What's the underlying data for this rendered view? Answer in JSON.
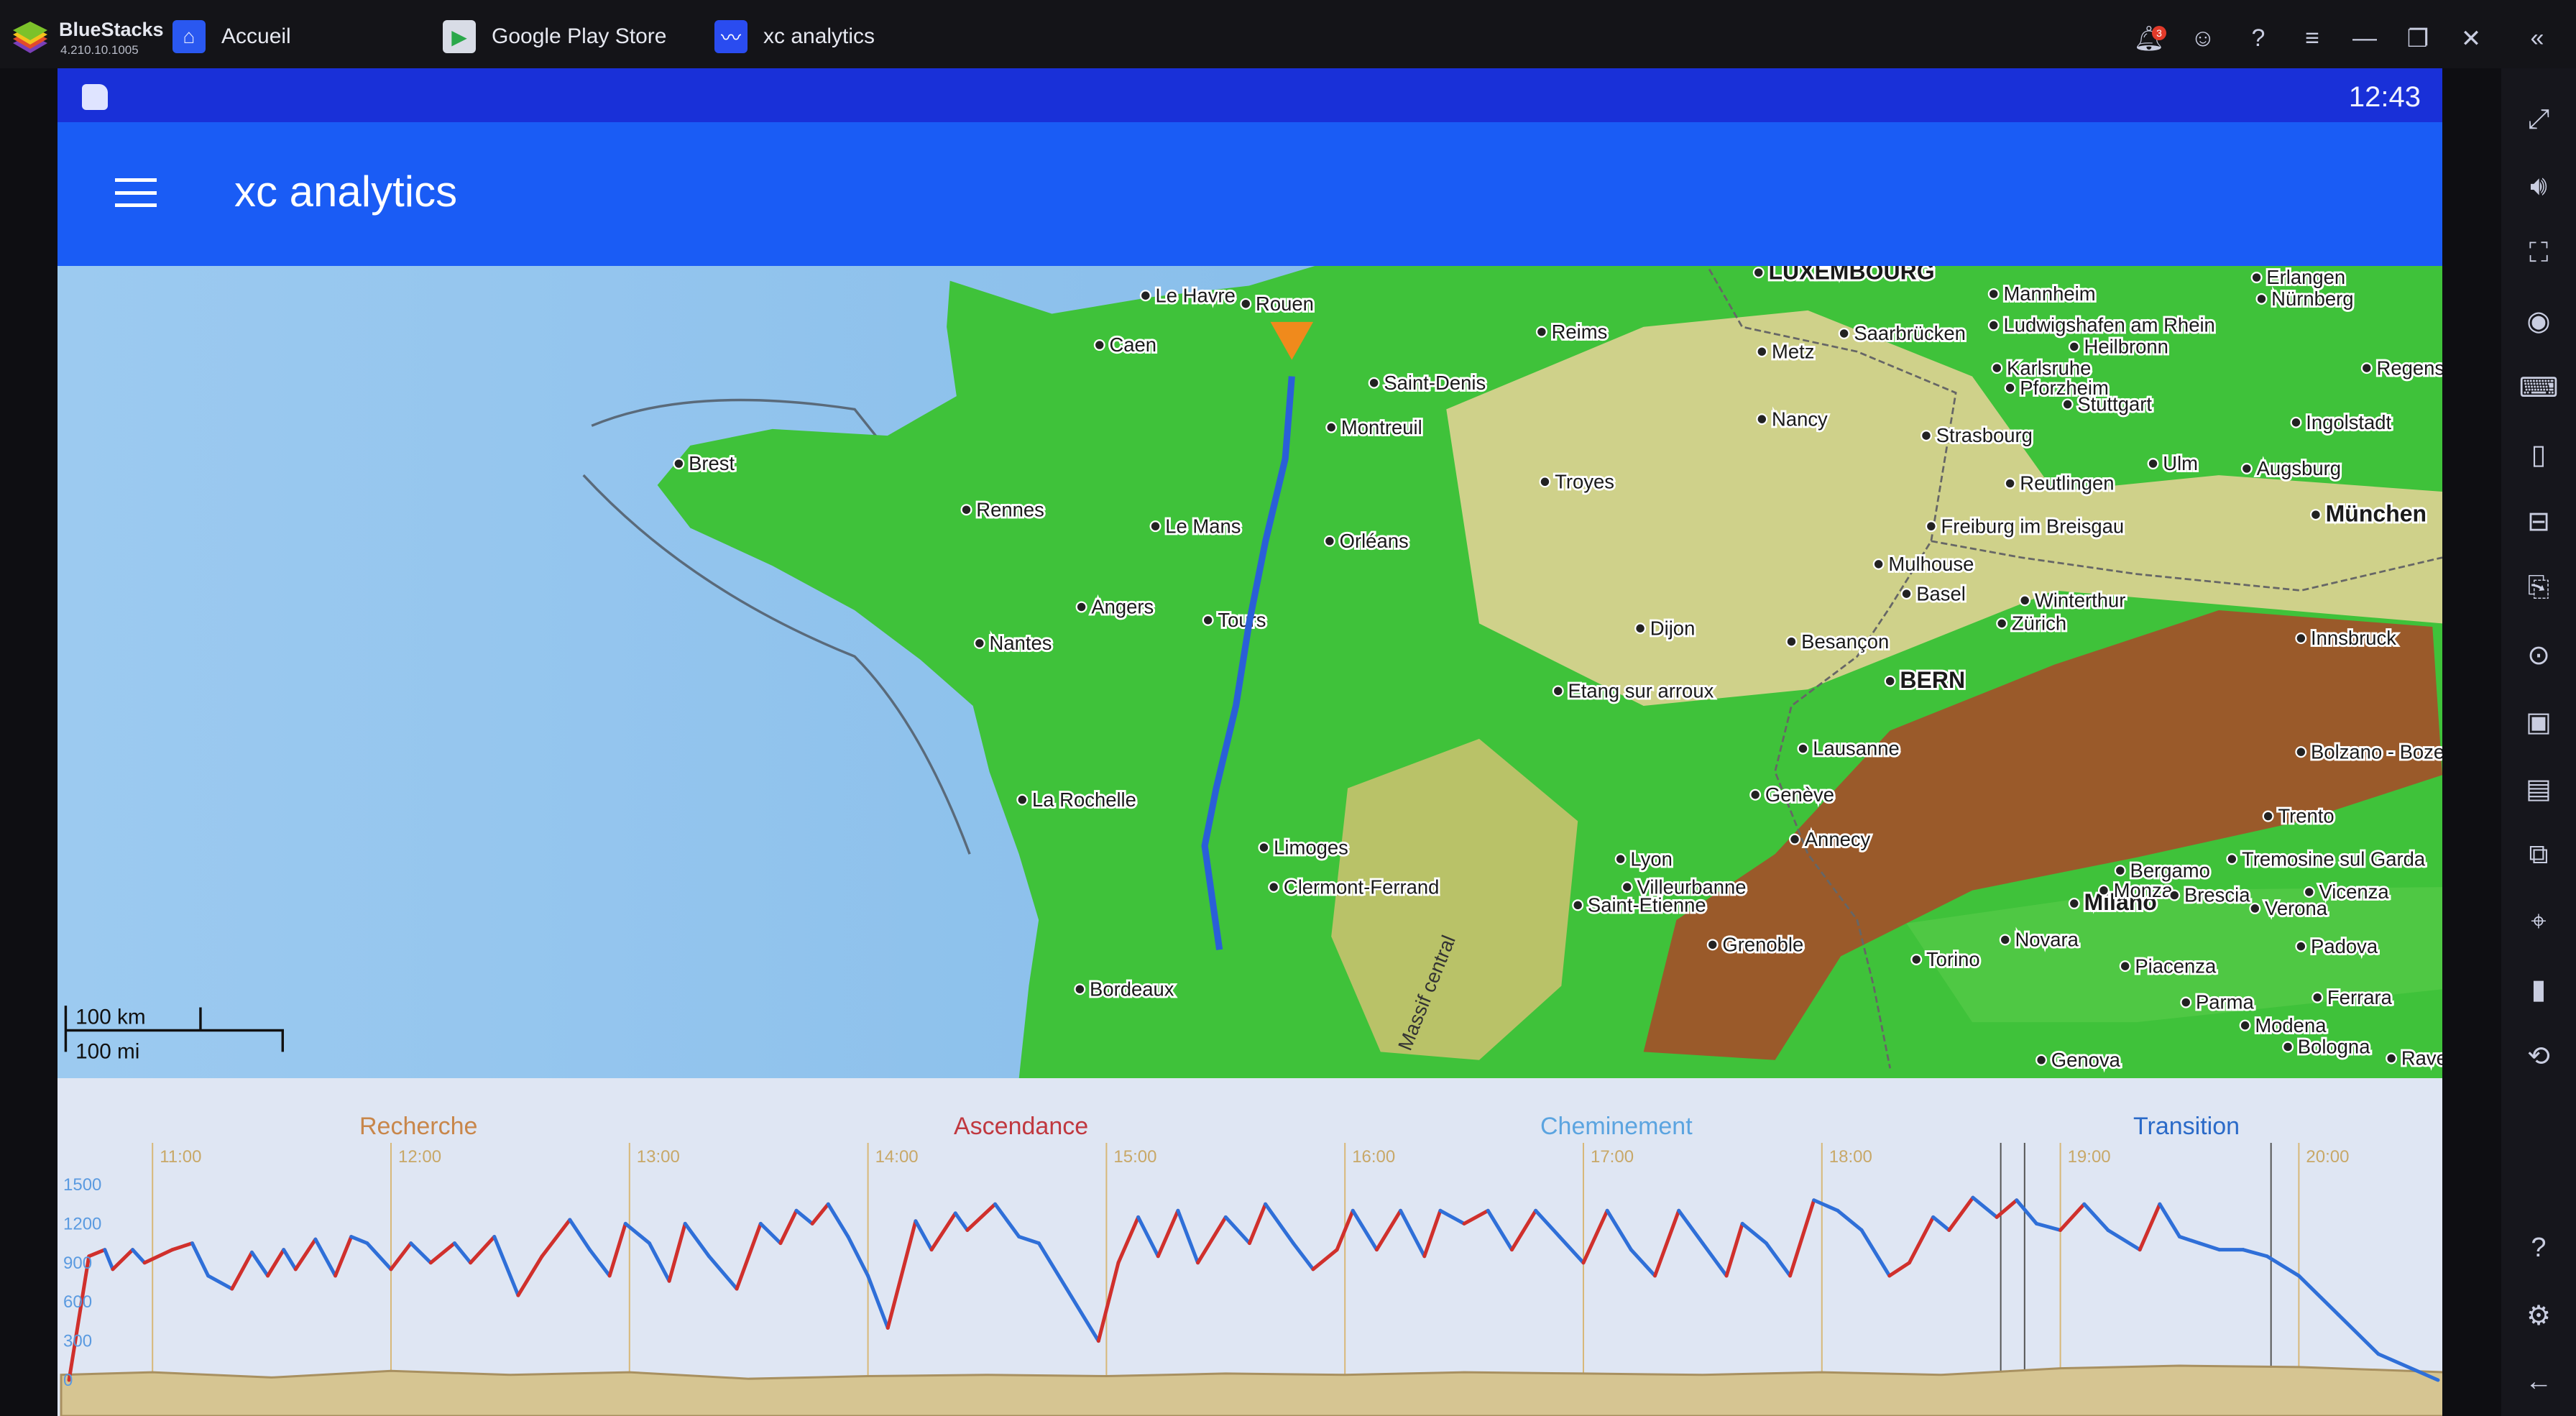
{
  "titlebar": {
    "brand": "BlueStacks",
    "version": "4.210.10.1005",
    "tabs": [
      {
        "label": "Accueil",
        "icon": "home-icon"
      },
      {
        "label": "Google Play Store",
        "icon": "play-store-icon"
      },
      {
        "label": "xc analytics",
        "icon": "xc-analytics-icon"
      }
    ],
    "notification_count": "3"
  },
  "status_bar": {
    "time": "12:43"
  },
  "app_bar": {
    "title": "xc analytics"
  },
  "map": {
    "scale": {
      "km": "100 km",
      "mi": "100 mi"
    },
    "region_labels": [
      "Massif central"
    ],
    "cities": [
      "Le Havre",
      "Rouen",
      "Caen",
      "Brest",
      "Rennes",
      "Le Mans",
      "Angers",
      "Tours",
      "Nantes",
      "Orléans",
      "Montreuil",
      "Saint-Denis",
      "Reims",
      "Troyes",
      "La Rochelle",
      "Limoges",
      "Clermont-Ferrand",
      "Bordeaux",
      "Dijon",
      "Besançon",
      "Etang sur arroux",
      "Lyon",
      "Villeurbanne",
      "Saint-Etienne",
      "Grenoble",
      "LUXEMBOURG",
      "Metz",
      "Nancy",
      "Saarbrücken",
      "Strasbourg",
      "Mulhouse",
      "Basel",
      "Freiburg im Breisgau",
      "BERN",
      "Lausanne",
      "Genève",
      "Annecy",
      "Torino",
      "Novara",
      "Milano",
      "Bergamo",
      "Monza",
      "Brescia",
      "Verona",
      "Vicenza",
      "Padova",
      "Trento",
      "Bolzano - Bozen",
      "Innsbruck",
      "München",
      "Augsburg",
      "Ingolstadt",
      "Ulm",
      "Reutlingen",
      "Stuttgart",
      "Pforzheim",
      "Karlsruhe",
      "Heilbronn",
      "Mannheim",
      "Ludwigshafen am Rhein",
      "Erlangen",
      "Nürnberg",
      "Regensburg",
      "Zürich",
      "Winterthur",
      "Piacenza",
      "Parma",
      "Modena",
      "Bologna",
      "Ferrara",
      "Genova",
      "Tremosine sul Garda",
      "Raven"
    ],
    "colors": {
      "sea": "#86c0ec",
      "lowland": "#3fc23a",
      "hills": "#d8d49a",
      "mountains": "#9a5a2a",
      "track": "#2a5fd8",
      "marker": "#f08a1c"
    }
  },
  "chart_data": {
    "type": "line",
    "phases": [
      {
        "label": "Recherche",
        "color": "#c8864a"
      },
      {
        "label": "Ascendance",
        "color": "#c0383f"
      },
      {
        "label": "Cheminement",
        "color": "#5ba4e0"
      },
      {
        "label": "Transition",
        "color": "#2a6ac8"
      }
    ],
    "x_ticks": [
      "11:00",
      "12:00",
      "13:00",
      "14:00",
      "15:00",
      "16:00",
      "17:00",
      "18:00",
      "19:00",
      "20:00"
    ],
    "y_ticks": [
      0,
      300,
      600,
      900,
      1200,
      1500
    ],
    "xlim": [
      "10:37",
      "20:37"
    ],
    "ylim": [
      0,
      1500
    ],
    "colors": {
      "climb": "#d0302c",
      "sink": "#2f6fd8",
      "ground": "#c8b27a"
    },
    "altitude": [
      [
        "10:39",
        0
      ],
      [
        "10:44",
        950
      ],
      [
        "10:48",
        1000
      ],
      [
        "10:50",
        850
      ],
      [
        "10:55",
        1000
      ],
      [
        "10:58",
        900
      ],
      [
        "11:05",
        1000
      ],
      [
        "11:10",
        1050
      ],
      [
        "11:14",
        800
      ],
      [
        "11:20",
        700
      ],
      [
        "11:25",
        980
      ],
      [
        "11:29",
        800
      ],
      [
        "11:33",
        1000
      ],
      [
        "11:36",
        850
      ],
      [
        "11:41",
        1080
      ],
      [
        "11:46",
        800
      ],
      [
        "11:50",
        1100
      ],
      [
        "11:54",
        1050
      ],
      [
        "12:00",
        850
      ],
      [
        "12:05",
        1050
      ],
      [
        "12:10",
        900
      ],
      [
        "12:16",
        1050
      ],
      [
        "12:20",
        900
      ],
      [
        "12:26",
        1100
      ],
      [
        "12:32",
        650
      ],
      [
        "12:38",
        950
      ],
      [
        "12:45",
        1230
      ],
      [
        "12:50",
        1000
      ],
      [
        "12:55",
        800
      ],
      [
        "12:59",
        1200
      ],
      [
        "13:05",
        1050
      ],
      [
        "13:10",
        760
      ],
      [
        "13:14",
        1200
      ],
      [
        "13:20",
        950
      ],
      [
        "13:27",
        700
      ],
      [
        "13:33",
        1200
      ],
      [
        "13:38",
        1050
      ],
      [
        "13:42",
        1300
      ],
      [
        "13:46",
        1200
      ],
      [
        "13:50",
        1350
      ],
      [
        "13:55",
        1100
      ],
      [
        "14:00",
        800
      ],
      [
        "14:05",
        400
      ],
      [
        "14:12",
        1220
      ],
      [
        "14:16",
        1000
      ],
      [
        "14:22",
        1280
      ],
      [
        "14:25",
        1150
      ],
      [
        "14:32",
        1350
      ],
      [
        "14:38",
        1100
      ],
      [
        "14:43",
        1050
      ],
      [
        "14:50",
        700
      ],
      [
        "14:58",
        300
      ],
      [
        "15:03",
        900
      ],
      [
        "15:08",
        1250
      ],
      [
        "15:13",
        950
      ],
      [
        "15:18",
        1300
      ],
      [
        "15:23",
        900
      ],
      [
        "15:30",
        1250
      ],
      [
        "15:36",
        1050
      ],
      [
        "15:40",
        1350
      ],
      [
        "15:47",
        1050
      ],
      [
        "15:52",
        850
      ],
      [
        "15:58",
        1000
      ],
      [
        "16:02",
        1300
      ],
      [
        "16:08",
        1000
      ],
      [
        "16:14",
        1300
      ],
      [
        "16:20",
        950
      ],
      [
        "16:24",
        1300
      ],
      [
        "16:30",
        1200
      ],
      [
        "16:36",
        1300
      ],
      [
        "16:42",
        1000
      ],
      [
        "16:48",
        1300
      ],
      [
        "16:54",
        1100
      ],
      [
        "17:00",
        900
      ],
      [
        "17:06",
        1300
      ],
      [
        "17:12",
        1000
      ],
      [
        "17:18",
        800
      ],
      [
        "17:24",
        1300
      ],
      [
        "17:30",
        1050
      ],
      [
        "17:36",
        800
      ],
      [
        "17:40",
        1200
      ],
      [
        "17:46",
        1050
      ],
      [
        "17:52",
        800
      ],
      [
        "17:58",
        1380
      ],
      [
        "18:04",
        1300
      ],
      [
        "18:10",
        1150
      ],
      [
        "18:17",
        800
      ],
      [
        "18:22",
        900
      ],
      [
        "18:28",
        1250
      ],
      [
        "18:32",
        1150
      ],
      [
        "18:38",
        1400
      ],
      [
        "18:44",
        1250
      ],
      [
        "18:49",
        1380
      ],
      [
        "18:54",
        1200
      ],
      [
        "19:00",
        1150
      ],
      [
        "19:06",
        1350
      ],
      [
        "19:12",
        1150
      ],
      [
        "19:20",
        1000
      ],
      [
        "19:25",
        1350
      ],
      [
        "19:30",
        1100
      ],
      [
        "19:35",
        1050
      ],
      [
        "19:40",
        1000
      ],
      [
        "19:46",
        1000
      ],
      [
        "19:52",
        950
      ],
      [
        "20:00",
        800
      ],
      [
        "20:10",
        500
      ],
      [
        "20:20",
        200
      ],
      [
        "20:35",
        0
      ]
    ],
    "ground": [
      [
        "10:37",
        40
      ],
      [
        "11:00",
        60
      ],
      [
        "11:30",
        20
      ],
      [
        "12:00",
        70
      ],
      [
        "12:30",
        40
      ],
      [
        "13:00",
        60
      ],
      [
        "13:30",
        10
      ],
      [
        "14:00",
        30
      ],
      [
        "14:30",
        40
      ],
      [
        "15:00",
        30
      ],
      [
        "15:30",
        50
      ],
      [
        "16:00",
        40
      ],
      [
        "16:30",
        60
      ],
      [
        "17:00",
        50
      ],
      [
        "17:30",
        40
      ],
      [
        "18:00",
        60
      ],
      [
        "18:30",
        40
      ],
      [
        "19:00",
        90
      ],
      [
        "19:30",
        110
      ],
      [
        "20:00",
        100
      ],
      [
        "20:37",
        60
      ]
    ]
  },
  "sidebar": {
    "icons": [
      "fullscreen-icon",
      "volume-icon",
      "screenshot-region-icon",
      "eye-icon",
      "keyboard-icon",
      "phone-icon",
      "gamepad-icon",
      "media-import-icon",
      "camera-icon",
      "video-record-icon",
      "folder-icon",
      "multi-instance-icon",
      "location-icon",
      "shake-icon",
      "rotate-icon",
      "help-icon",
      "settings-icon",
      "back-icon"
    ]
  }
}
